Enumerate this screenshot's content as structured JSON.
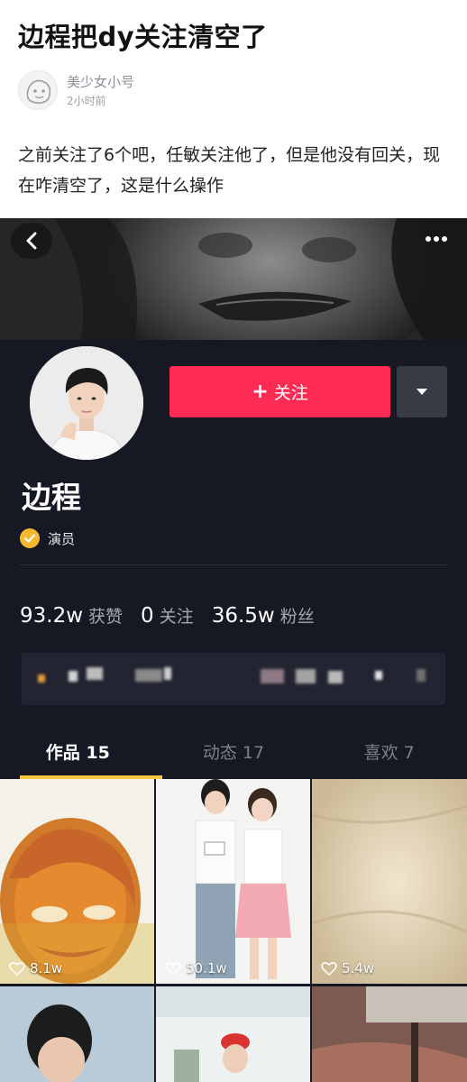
{
  "post": {
    "title": "边程把dy关注清空了",
    "author_name": "美少女小号",
    "time": "2小时前",
    "body": "之前关注了6个吧，任敏关注他了，但是他没有回关，现在咋清空了，这是什么操作"
  },
  "cover": {
    "back_icon": "chevron-left-icon",
    "more_icon": "more-dots-icon"
  },
  "profile": {
    "follow_label": "关注",
    "name": "边程",
    "verified_label": "演员",
    "stats": [
      {
        "value": "93.2w",
        "label": "获赞"
      },
      {
        "value": "0",
        "label": "关注"
      },
      {
        "value": "36.5w",
        "label": "粉丝"
      }
    ],
    "tabs": [
      {
        "label": "作品 15"
      },
      {
        "label": "动态 17"
      },
      {
        "label": "喜欢 7"
      }
    ],
    "videos": [
      {
        "likes": "8.1w"
      },
      {
        "likes": "50.1w"
      },
      {
        "likes": "5.4w"
      }
    ]
  },
  "colors": {
    "accent": "#fe2c55",
    "background": "#161823",
    "tab_indicator": "#f8c93e",
    "verified": "#f7b731"
  }
}
